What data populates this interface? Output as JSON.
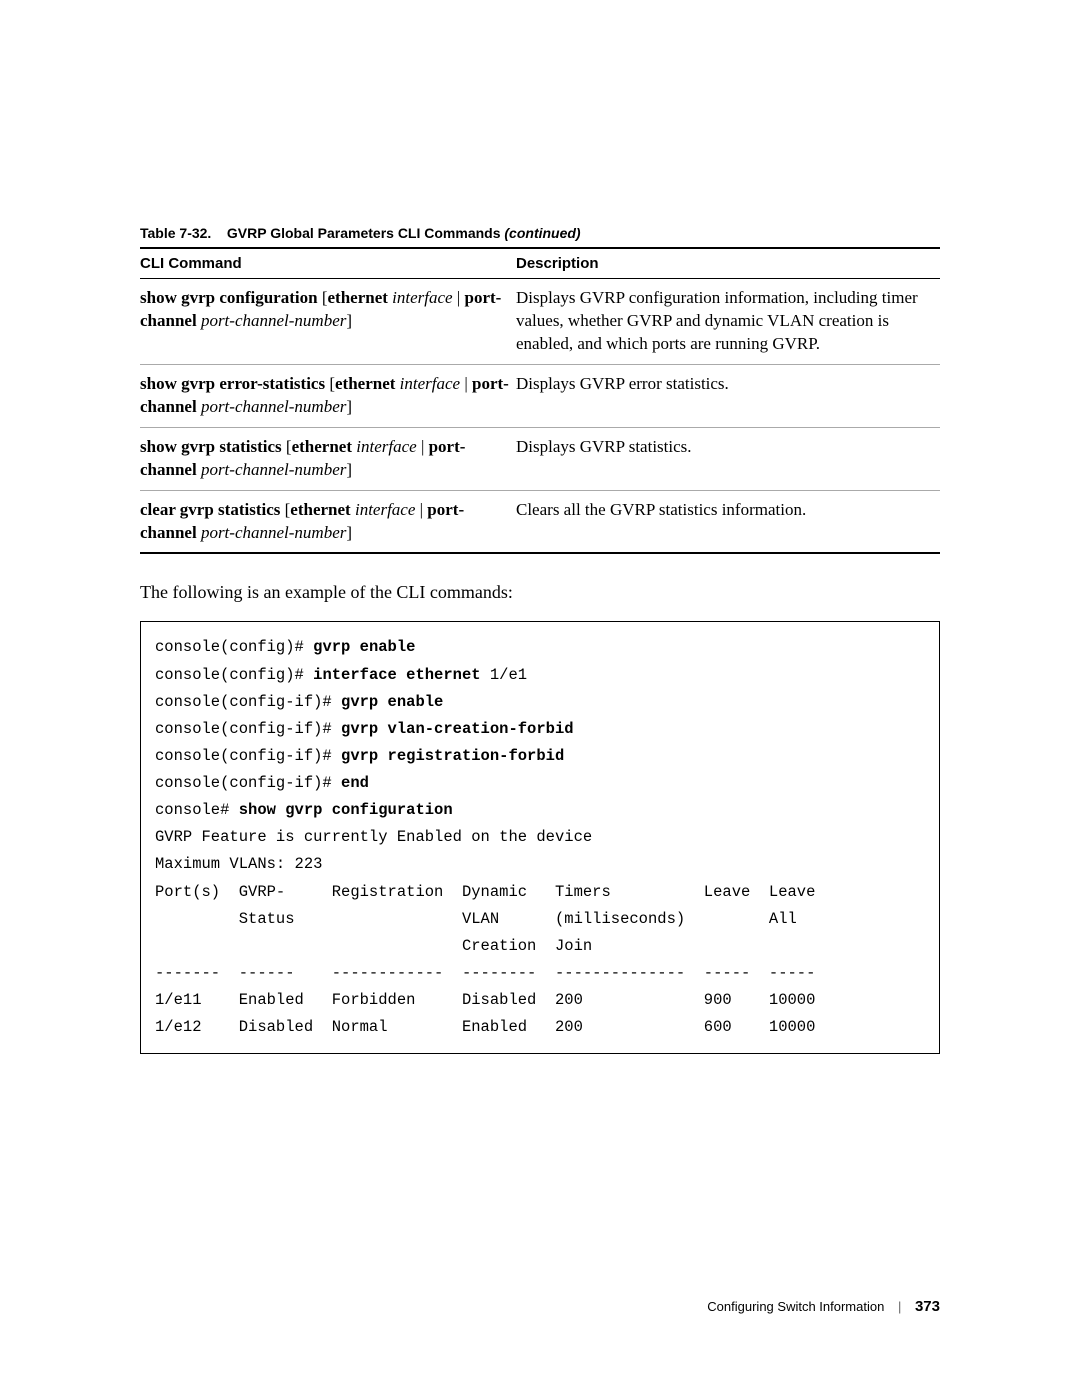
{
  "table": {
    "caption_num": "Table 7-32.",
    "caption_title": "GVRP Global Parameters CLI Commands",
    "caption_cont": "(continued)",
    "headers": {
      "cmd": "CLI Command",
      "desc": "Description"
    },
    "rows": [
      {
        "cmd_parts": [
          {
            "t": "show gvrp configuration   ",
            "b": true
          },
          {
            "t": "[",
            "b": false
          },
          {
            "t": "ethernet",
            "b": true
          },
          {
            "t": " ",
            "b": false
          },
          {
            "t": "interface",
            "i": true
          },
          {
            "t": " |   ",
            "b": false
          },
          {
            "t": "port-channel",
            "b": true
          },
          {
            "t": "  ",
            "b": false
          },
          {
            "t": "port-channel-number",
            "i": true
          },
          {
            "t": "]",
            "b": false
          }
        ],
        "desc": "Displays GVRP configuration information, including timer values, whether GVRP and dynamic VLAN creation is enabled, and which ports are running GVRP."
      },
      {
        "cmd_parts": [
          {
            "t": "show gvrp error-statistics   ",
            "b": true
          },
          {
            "t": "[",
            "b": false
          },
          {
            "t": "ethernet",
            "b": true
          },
          {
            "t": " ",
            "b": false
          },
          {
            "t": "interface",
            "i": true
          },
          {
            "t": " |   ",
            "b": false
          },
          {
            "t": "port-channel",
            "b": true
          },
          {
            "t": "  ",
            "b": false
          },
          {
            "t": "port-channel-number",
            "i": true
          },
          {
            "t": "]",
            "b": false
          }
        ],
        "desc": "Displays GVRP error statistics."
      },
      {
        "cmd_parts": [
          {
            "t": "show gvrp statistics   ",
            "b": true
          },
          {
            "t": "[",
            "b": false
          },
          {
            "t": "ethernet",
            "b": true
          },
          {
            "t": " ",
            "b": false
          },
          {
            "t": "interface",
            "i": true
          },
          {
            "t": " |  ",
            "b": false
          },
          {
            "t": "port-channel",
            "b": true
          },
          {
            "t": " ",
            "b": false
          },
          {
            "t": "port-channel-number",
            "i": true
          },
          {
            "t": "]",
            "b": false
          }
        ],
        "desc": "Displays GVRP statistics."
      },
      {
        "cmd_parts": [
          {
            "t": "clear gvrp statistics   ",
            "b": true
          },
          {
            "t": "[",
            "b": false
          },
          {
            "t": "ethernet",
            "b": true
          },
          {
            "t": " ",
            "b": false
          },
          {
            "t": "interface",
            "i": true
          },
          {
            "t": " |  ",
            "b": false
          },
          {
            "t": "port-channel",
            "b": true
          },
          {
            "t": " ",
            "b": false
          },
          {
            "t": "port-channel-number",
            "i": true
          },
          {
            "t": "]",
            "b": false
          }
        ],
        "desc": "Clears all the GVRP statistics information."
      }
    ]
  },
  "intro": "The following is an example of the CLI commands:",
  "cli": {
    "lines": [
      [
        {
          "t": "console(config)# "
        },
        {
          "t": "gvrp enable",
          "b": true
        }
      ],
      [
        {
          "t": "console(config)# "
        },
        {
          "t": "interface ethernet",
          "b": true
        },
        {
          "t": " 1/e1"
        }
      ],
      [
        {
          "t": "console(config-if)# "
        },
        {
          "t": "gvrp enable",
          "b": true
        }
      ],
      [
        {
          "t": "console(config-if)# "
        },
        {
          "t": "gvrp vlan-creation-forbid",
          "b": true
        }
      ],
      [
        {
          "t": "console(config-if)# "
        },
        {
          "t": "gvrp registration-forbid",
          "b": true
        }
      ],
      [
        {
          "t": "console(config-if)# "
        },
        {
          "t": "end",
          "b": true
        }
      ],
      [
        {
          "t": "console# "
        },
        {
          "t": "show gvrp configuration",
          "b": true
        }
      ],
      [
        {
          "t": "GVRP Feature is currently Enabled on the device"
        }
      ],
      [
        {
          "t": "Maximum VLANs: 223"
        }
      ],
      [
        {
          "t": "Port(s)  GVRP-     Registration  Dynamic   Timers          Leave  Leave"
        }
      ],
      [
        {
          "t": "         Status                  VLAN      (milliseconds)         All"
        }
      ],
      [
        {
          "t": "                                 Creation  Join"
        }
      ],
      [
        {
          "t": "-------  ------    ------------  --------  --------------  -----  -----"
        }
      ],
      [
        {
          "t": "1/e11    Enabled   Forbidden     Disabled  200             900    10000"
        }
      ],
      [
        {
          "t": "1/e12    Disabled  Normal        Enabled   200             600    10000"
        }
      ]
    ]
  },
  "footer": {
    "section": "Configuring Switch Information",
    "page": "373"
  }
}
